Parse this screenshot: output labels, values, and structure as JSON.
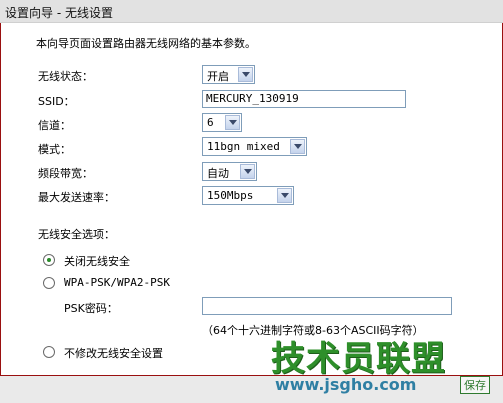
{
  "window": {
    "title": "设置向导 - 无线设置"
  },
  "intro": "本向导页面设置路由器无线网络的基本参数。",
  "fields": {
    "wireless_status": {
      "label": "无线状态：",
      "value": "开启"
    },
    "ssid": {
      "label": "SSID：",
      "value": "MERCURY_130919"
    },
    "channel": {
      "label": "信道：",
      "value": "6"
    },
    "mode": {
      "label": "模式：",
      "value": "11bgn mixed"
    },
    "bandwidth": {
      "label": "频段带宽：",
      "value": "自动"
    },
    "max_rate": {
      "label": "最大发送速率：",
      "value": "150Mbps"
    }
  },
  "security": {
    "heading": "无线安全选项：",
    "options": [
      {
        "label": "关闭无线安全",
        "selected": true
      },
      {
        "label": "WPA-PSK/WPA2-PSK",
        "selected": false
      },
      {
        "label": "不修改无线安全设置",
        "selected": false
      }
    ],
    "psk_label": "PSK密码：",
    "psk_value": "",
    "psk_hint": "（64个十六进制字符或8-63个ASCII码字符）"
  },
  "watermark": {
    "text": "技术员联盟",
    "url": "www.jsgho.com"
  },
  "buttons": {
    "save": "保存"
  },
  "colors": {
    "panel_border": "#9a1010",
    "radio_dot": "#2a8b2a",
    "watermark_green": "#2e8f2a"
  }
}
